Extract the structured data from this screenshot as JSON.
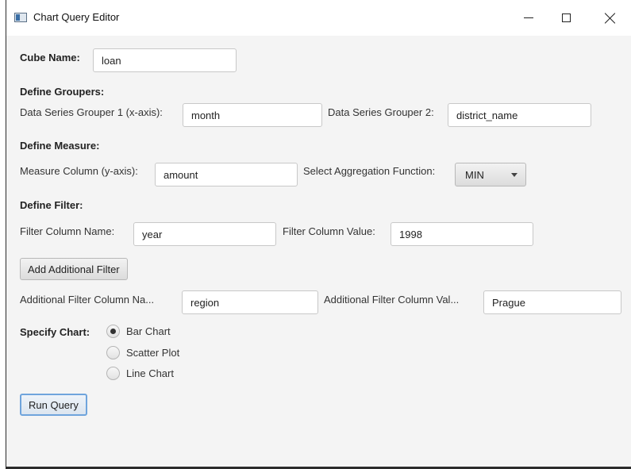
{
  "window": {
    "title": "Chart Query Editor"
  },
  "cube": {
    "label": "Cube Name:",
    "value": "loan"
  },
  "groupers": {
    "heading": "Define Groupers:",
    "g1_label": "Data Series Grouper 1 (x-axis):",
    "g1_value": "month",
    "g2_label": "Data Series Grouper 2:",
    "g2_value": "district_name"
  },
  "measure": {
    "heading": "Define Measure:",
    "column_label": "Measure Column (y-axis):",
    "column_value": "amount",
    "agg_label": "Select Aggregation Function:",
    "agg_value": "MIN"
  },
  "filter": {
    "heading": "Define Filter:",
    "name_label": "Filter Column Name:",
    "name_value": "year",
    "value_label": "Filter Column Value:",
    "value_value": "1998",
    "add_button": "Add Additional Filter",
    "add_name_label": "Additional Filter Column Na...",
    "add_name_value": "region",
    "add_value_label": "Additional Filter Column Val...",
    "add_value_value": "Prague"
  },
  "chart": {
    "label": "Specify Chart:",
    "options": [
      "Bar Chart",
      "Scatter Plot",
      "Line Chart"
    ],
    "selected": "Bar Chart"
  },
  "run_button": "Run Query"
}
